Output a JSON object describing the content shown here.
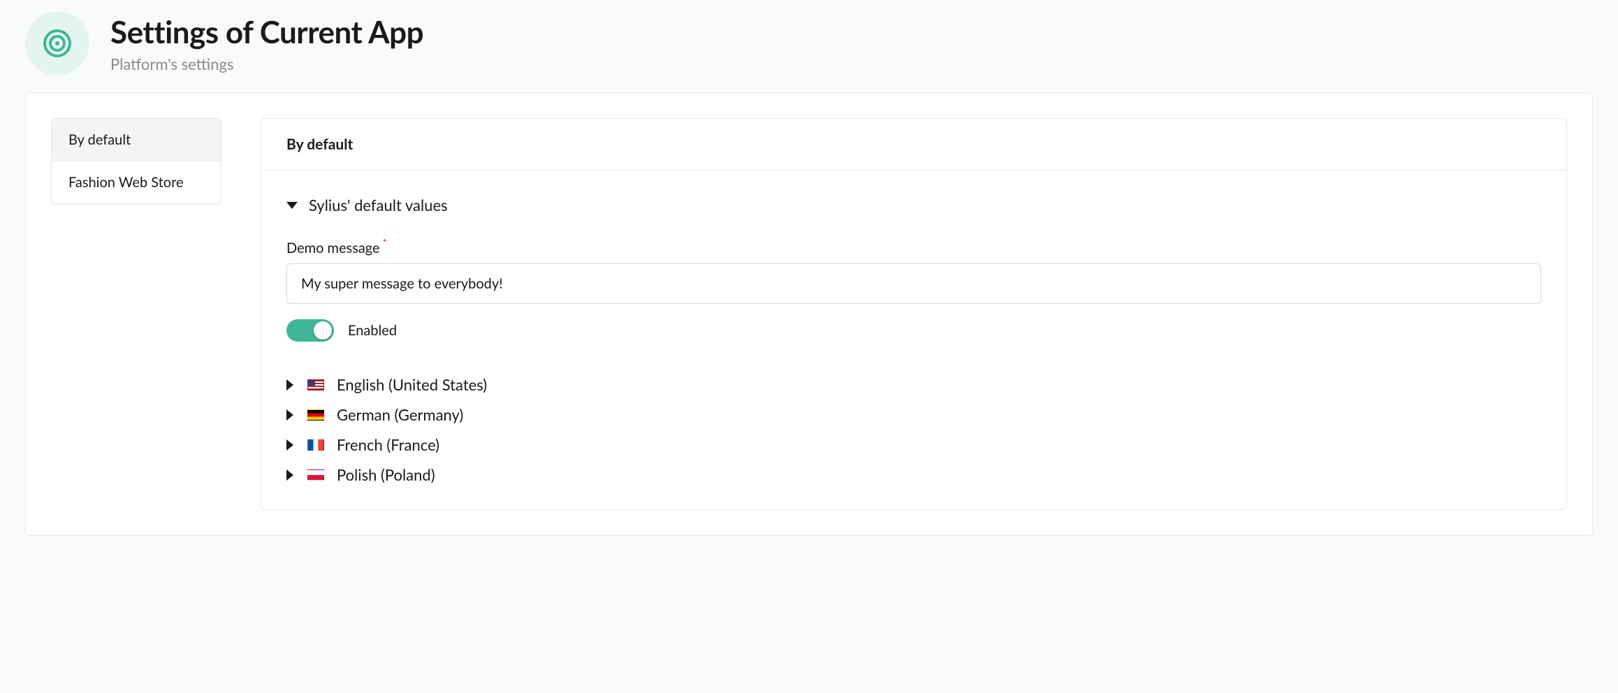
{
  "header": {
    "title": "Settings of Current App",
    "subtitle": "Platform's settings"
  },
  "sidebar": {
    "items": [
      {
        "label": "By default",
        "active": true
      },
      {
        "label": "Fashion Web Store",
        "active": false
      }
    ]
  },
  "content": {
    "title": "By default",
    "section_title": "Sylius' default values",
    "demo_message": {
      "label": "Demo message",
      "required": true,
      "value": "My super message to everybody!"
    },
    "enabled": {
      "label": "Enabled",
      "value": true
    },
    "locales": [
      {
        "label": "English (United States)",
        "flag": "us"
      },
      {
        "label": "German (Germany)",
        "flag": "de"
      },
      {
        "label": "French (France)",
        "flag": "fr"
      },
      {
        "label": "Polish (Poland)",
        "flag": "pl"
      }
    ]
  },
  "colors": {
    "accent": "#3fb697"
  }
}
